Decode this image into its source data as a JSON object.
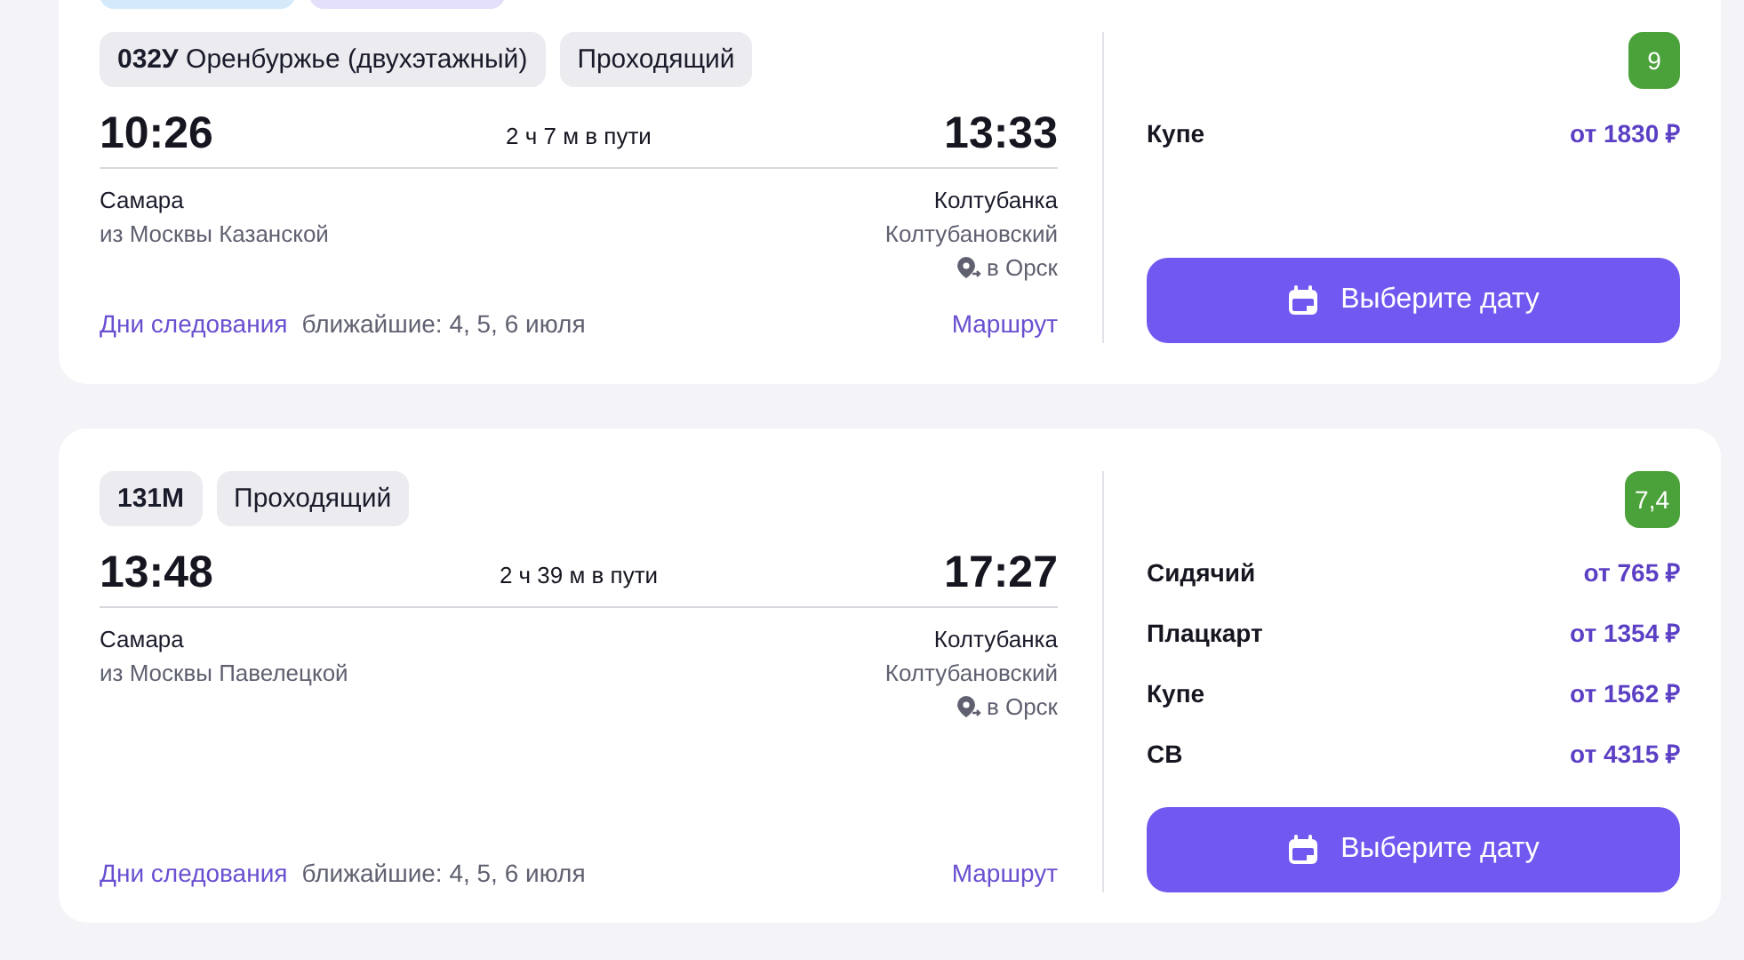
{
  "trains": [
    {
      "cut_tags": [
        {
          "color": "#d4eafb"
        },
        {
          "color": "#e4e0fb"
        }
      ],
      "tags": [
        {
          "label": "**032У** Оренбуржье (двухэтажный)",
          "bold": false
        },
        {
          "label": "Проходящий",
          "bold": false
        }
      ],
      "departure_time": "10:26",
      "duration": "2 ч 7 м в пути",
      "arrival_time": "13:33",
      "from_city": "Самара",
      "from_station": "из Москвы Казанской",
      "to_city": "Колтубанка",
      "to_station": "Колтубановский",
      "transfer": "в Орск",
      "days_link": "Дни следования",
      "nearest": "ближайшие: 4, 5, 6 июля",
      "route_link": "Маршрут",
      "rating": "9",
      "prices": [
        {
          "class": "Купе",
          "price": "от 1830 ₽"
        }
      ],
      "button": "Выберите дату"
    },
    {
      "tags": [
        {
          "label": "131М",
          "bold": true
        },
        {
          "label": "Проходящий",
          "bold": false
        }
      ],
      "departure_time": "13:48",
      "duration": "2 ч 39 м в пути",
      "arrival_time": "17:27",
      "from_city": "Самара",
      "from_station": "из Москвы Павелецкой",
      "to_city": "Колтубанка",
      "to_station": "Колтубановский",
      "transfer": "в Орск",
      "days_link": "Дни следования",
      "nearest": "ближайшие: 4, 5, 6 июля",
      "route_link": "Маршрут",
      "rating": "7,4",
      "prices": [
        {
          "class": "Сидячий",
          "price": "от 765 ₽"
        },
        {
          "class": "Плацкарт",
          "price": "от 1354 ₽"
        },
        {
          "class": "Купе",
          "price": "от 1562 ₽"
        },
        {
          "class": "СВ",
          "price": "от 4315 ₽"
        }
      ],
      "button": "Выберите дату"
    }
  ]
}
